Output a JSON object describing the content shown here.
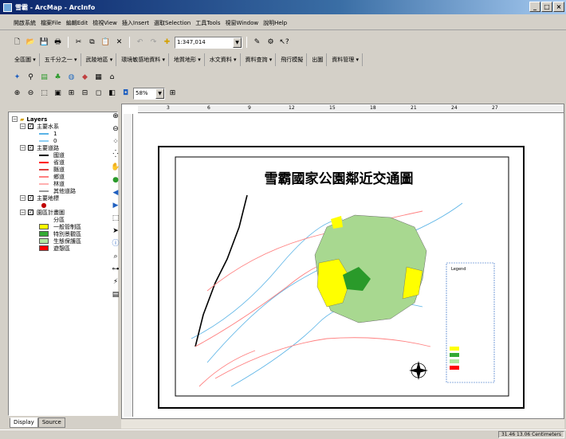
{
  "window": {
    "title": "雪霸 - ArcMap - ArcInfo",
    "min": "_",
    "max": "□",
    "close": "×"
  },
  "menubar": [
    "開啟系統",
    "檔案File",
    "編輯Edit",
    "檢視View",
    "插入Insert",
    "選取Selection",
    "工具Tools",
    "視窗Window",
    "說明Help"
  ],
  "toolbar": {
    "scale": "1:347,014",
    "zoom": "58%"
  },
  "custom_menus": [
    "全區圖 ▾",
    "五千分之一 ▾",
    "武陵地區 ▾",
    "環境敏感地資料 ▾",
    "地質地形 ▾",
    "水文資料 ▾",
    "資料查詢 ▾",
    "飛行模擬",
    "出圖",
    "資料管理 ▾"
  ],
  "toc": {
    "root": "Layers",
    "layers": [
      {
        "name": "主要水系",
        "items": [
          {
            "label": "1",
            "color": "#59b3e6",
            "kind": "line"
          },
          {
            "label": "0",
            "color": "#8fd0f5",
            "kind": "line"
          }
        ]
      },
      {
        "name": "主要道路",
        "items": [
          {
            "label": "國道",
            "color": "#000000",
            "kind": "line"
          },
          {
            "label": "省道",
            "color": "#ff0000",
            "kind": "line"
          },
          {
            "label": "縣道",
            "color": "#e04040",
            "kind": "line"
          },
          {
            "label": "鄉道",
            "color": "#ff8080",
            "kind": "line"
          },
          {
            "label": "林道",
            "color": "#ffb0b0",
            "kind": "line"
          },
          {
            "label": "其他道路",
            "color": "#999999",
            "kind": "line"
          }
        ]
      },
      {
        "name": "主要地標",
        "items": [
          {
            "label": "",
            "color": "#c00000",
            "kind": "dot"
          }
        ]
      },
      {
        "name": "園區計畫圖",
        "sublabel": "分區",
        "items": [
          {
            "label": "一般管制區",
            "color": "#ffff00",
            "kind": "box"
          },
          {
            "label": "特別景觀區",
            "color": "#33aa33",
            "kind": "box"
          },
          {
            "label": "生態保護區",
            "color": "#b0e8a0",
            "kind": "box"
          },
          {
            "label": "遊憩區",
            "color": "#ff0000",
            "kind": "box"
          }
        ]
      }
    ],
    "tabs": [
      "Display",
      "Source"
    ]
  },
  "map": {
    "title": "雪霸國家公園鄰近交通圖",
    "legend_title": "Legend",
    "legend_items": [
      "1",
      "0",
      "國道",
      "省道",
      "縣道",
      "鄉道",
      "林道",
      "其他道路",
      "主要地標",
      "分區",
      "一般管制區",
      "特別景觀區",
      "生態保護區",
      "遊憩區"
    ],
    "north_arrow_label": "N"
  },
  "ruler": {
    "ticks": [
      "3",
      "6",
      "9",
      "12",
      "15",
      "18",
      "21",
      "24",
      "27"
    ]
  },
  "status": {
    "coords": "31.46 13.06 Centimeters"
  },
  "colors": {
    "park_green": "#a8d890",
    "park_yellow": "#ffff00",
    "park_dark": "#2a9a2a"
  }
}
